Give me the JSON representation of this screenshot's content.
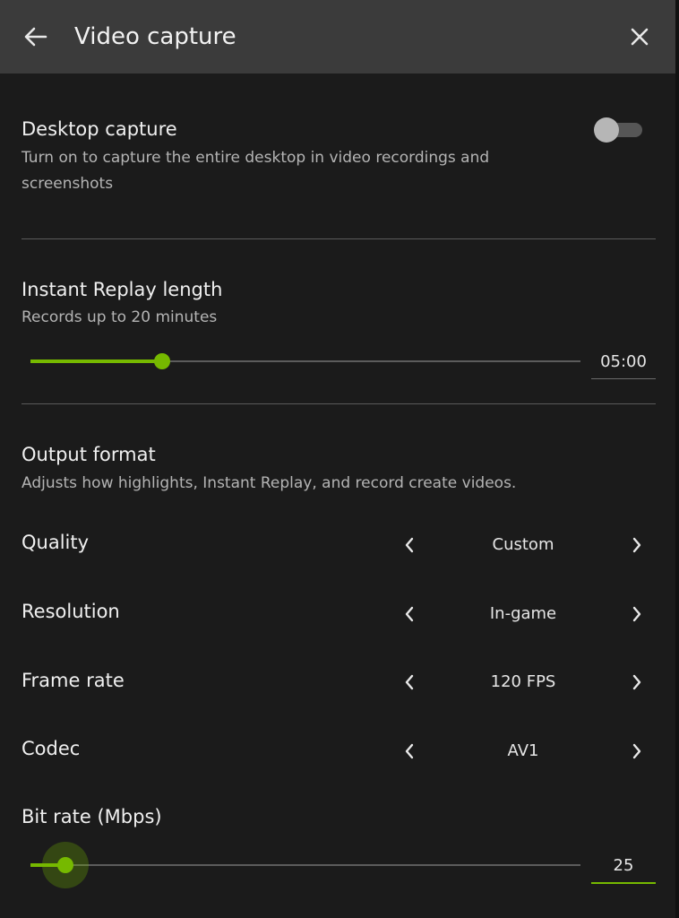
{
  "header": {
    "title": "Video capture",
    "back_icon": "arrow-left-icon",
    "close_icon": "close-icon"
  },
  "desktop_capture": {
    "title": "Desktop capture",
    "description": "Turn on to capture the entire desktop in video recordings and screenshots",
    "enabled": false
  },
  "instant_replay": {
    "title": "Instant Replay length",
    "description": "Records up to 20 minutes",
    "value": "05:00",
    "fraction": 0.24
  },
  "output_format": {
    "title": "Output format",
    "description": "Adjusts how highlights, Instant Replay, and record create videos.",
    "rows": [
      {
        "label": "Quality",
        "value": "Custom"
      },
      {
        "label": "Resolution",
        "value": "In-game"
      },
      {
        "label": "Frame rate",
        "value": "120 FPS"
      },
      {
        "label": "Codec",
        "value": "AV1"
      }
    ]
  },
  "bit_rate": {
    "title": "Bit rate (Mbps)",
    "value": "25",
    "fraction": 0.063
  },
  "colors": {
    "accent": "#76b900",
    "background": "#1b1b1b",
    "header": "#3b3b3b"
  }
}
